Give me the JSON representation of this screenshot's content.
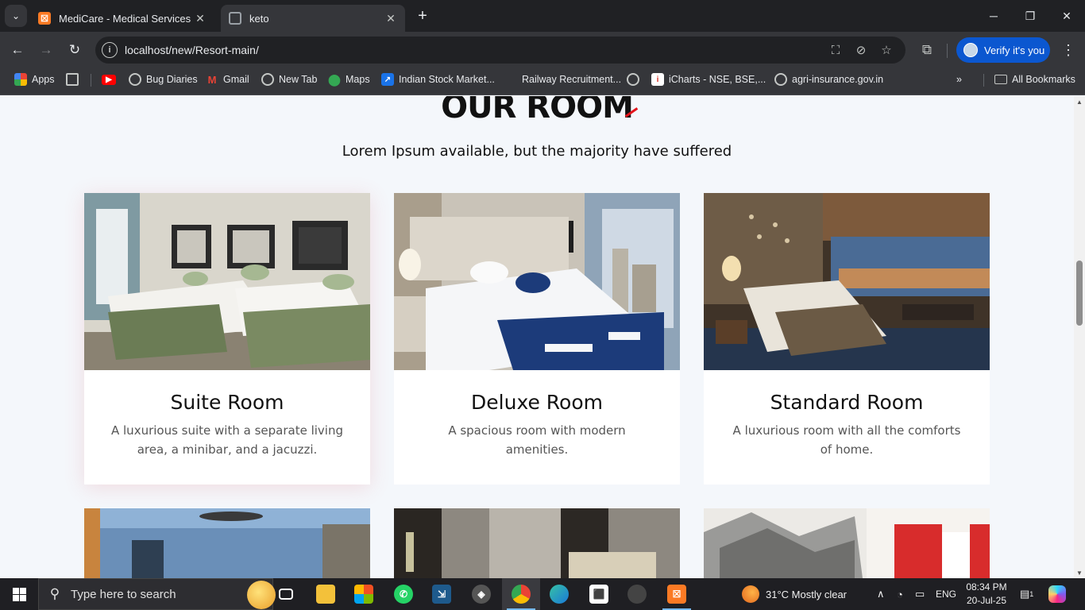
{
  "browser": {
    "tabs": [
      {
        "title": "MediCare - Medical Services",
        "icon": "xampp-icon",
        "active": false
      },
      {
        "title": "keto",
        "icon": "globe-icon",
        "active": true
      }
    ],
    "url": "localhost/new/Resort-main/",
    "verify_label": "Verify it's you",
    "bookmarks": [
      {
        "label": "Apps",
        "icon": "apps-grid-icon"
      },
      {
        "label": "",
        "icon": "grid-icon"
      },
      {
        "label": "",
        "icon": "youtube-icon"
      },
      {
        "label": "Bug Diaries",
        "icon": "globe-icon"
      },
      {
        "label": "Gmail",
        "icon": "gmail-icon"
      },
      {
        "label": "New Tab",
        "icon": "globe-icon"
      },
      {
        "label": "Maps",
        "icon": "maps-icon"
      },
      {
        "label": "Indian Stock Market...",
        "icon": "stock-icon"
      },
      {
        "label": "Railway Recruitment...",
        "icon": "railway-icon"
      },
      {
        "label": "",
        "icon": "globe-icon"
      },
      {
        "label": "iCharts - NSE, BSE,...",
        "icon": "icharts-icon"
      },
      {
        "label": "agri-insurance.gov.in",
        "icon": "globe-icon"
      }
    ],
    "all_bookmarks": "All Bookmarks"
  },
  "page": {
    "heading": "OUR ROOM",
    "subtitle": "Lorem Ipsum available, but the majority have suffered",
    "rooms": [
      {
        "name": "Suite Room",
        "description": "A luxurious suite with a separate living area, a minibar, and a jacuzzi."
      },
      {
        "name": "Deluxe Room",
        "description": "A spacious room with modern amenities."
      },
      {
        "name": "Standard Room",
        "description": "A luxurious room with all the comforts of home."
      }
    ],
    "accent_color": "#e3141b"
  },
  "taskbar": {
    "search_placeholder": "Type here to search",
    "weather": "31°C  Mostly clear",
    "language": "ENG",
    "time": "08:34 PM",
    "date": "20-Jul-25",
    "notification_count": "1"
  }
}
